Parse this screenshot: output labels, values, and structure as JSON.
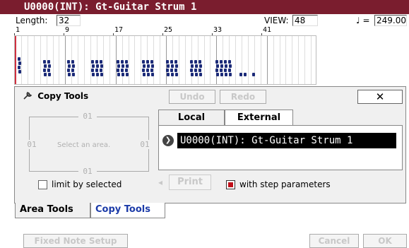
{
  "title": "U0000(INT): Gt-Guitar Strum 1",
  "topbar": {
    "length_label": "Length:",
    "length_value": "32",
    "view_label": "VIEW:",
    "view_value": "48",
    "tempo_symbol": "♩ =",
    "tempo_value": "249.00"
  },
  "ruler": {
    "marks": [
      "1",
      "9",
      "17",
      "25",
      "33",
      "41"
    ]
  },
  "panel": {
    "title": "Copy Tools",
    "undo_label": "Undo",
    "redo_label": "Redo",
    "close_label": "✕",
    "area": {
      "top": "01",
      "left": "01",
      "right": "01",
      "bottom": "01",
      "hint": "Select an area."
    },
    "limit_label": "limit by selected",
    "tabs_bottom": [
      "Area Tools",
      "Copy Tools"
    ],
    "ext_tabs": [
      "Local",
      "External"
    ],
    "selected_pattern": "U0000(INT): Gt-Guitar Strum 1",
    "print_label": "Print",
    "print_arrow": "◂",
    "with_step_label": "with step parameters"
  },
  "bottom": {
    "fixed_note_label": "Fixed Note Setup",
    "cancel_label": "Cancel",
    "ok_label": "OK"
  },
  "colors": {
    "titlebar": "#7a1d2e",
    "note": "#1b2a78",
    "checkbox_red": "#c0101a"
  }
}
